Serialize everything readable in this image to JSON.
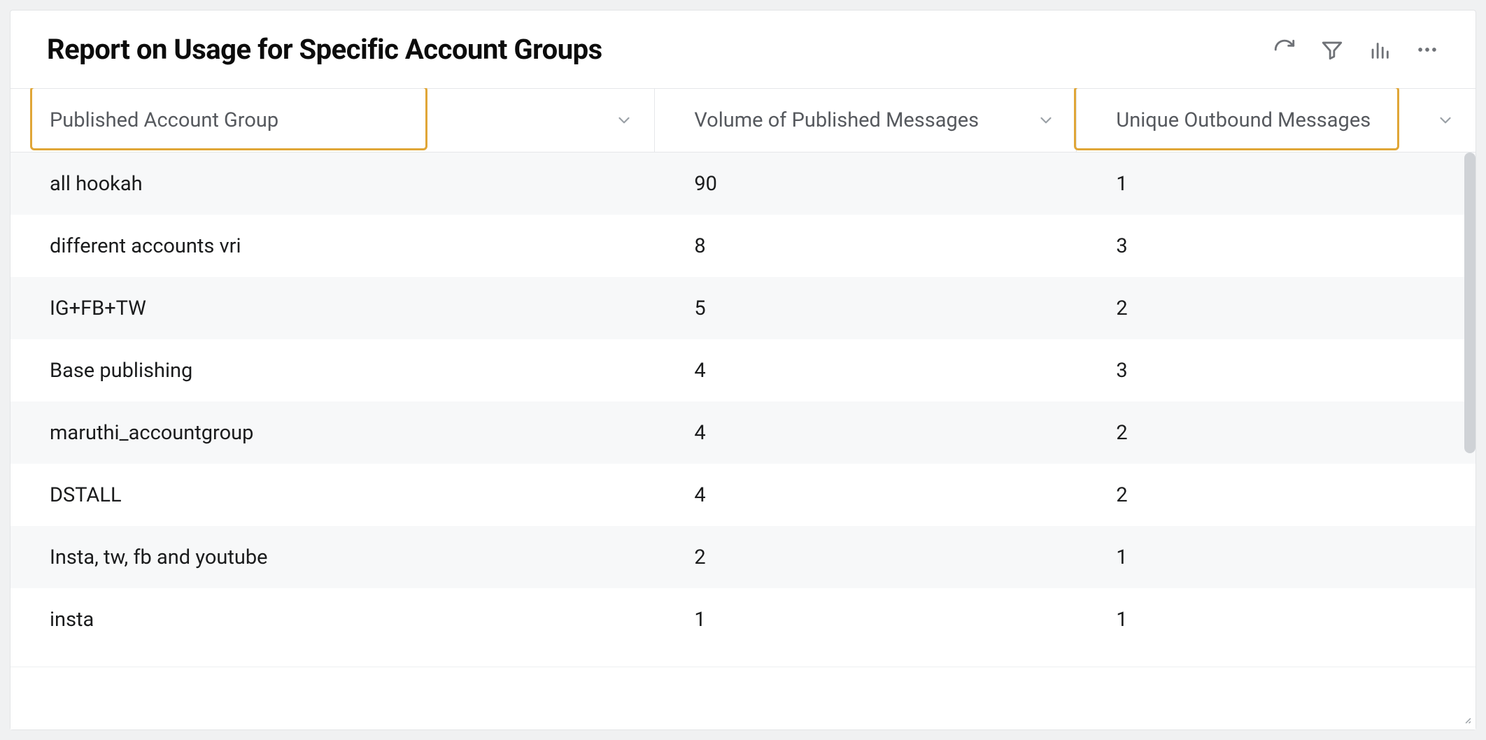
{
  "report": {
    "title": "Report on Usage for Specific Account Groups"
  },
  "columns": {
    "c1": "Published Account Group",
    "c2": "Volume of Published Messages",
    "c3": "Unique Outbound Messages"
  },
  "rows": [
    {
      "group": "all hookah",
      "volume": "90",
      "unique": "1"
    },
    {
      "group": "different accounts vri",
      "volume": "8",
      "unique": "3"
    },
    {
      "group": "IG+FB+TW",
      "volume": "5",
      "unique": "2"
    },
    {
      "group": "Base publishing",
      "volume": "4",
      "unique": "3"
    },
    {
      "group": "maruthi_accountgroup",
      "volume": "4",
      "unique": "2"
    },
    {
      "group": "DSTALL",
      "volume": "4",
      "unique": "2"
    },
    {
      "group": "Insta, tw, fb and youtube",
      "volume": "2",
      "unique": "1"
    },
    {
      "group": "insta",
      "volume": "1",
      "unique": "1"
    }
  ],
  "chart_data": {
    "type": "table",
    "columns": [
      "Published Account Group",
      "Volume of Published Messages",
      "Unique Outbound Messages"
    ],
    "rows": [
      [
        "all hookah",
        90,
        1
      ],
      [
        "different accounts vri",
        8,
        3
      ],
      [
        "IG+FB+TW",
        5,
        2
      ],
      [
        "Base publishing",
        4,
        3
      ],
      [
        "maruthi_accountgroup",
        4,
        2
      ],
      [
        "DSTALL",
        4,
        2
      ],
      [
        "Insta, tw, fb and youtube",
        2,
        1
      ],
      [
        "insta",
        1,
        1
      ]
    ],
    "title": "Report on Usage for Specific Account Groups"
  }
}
